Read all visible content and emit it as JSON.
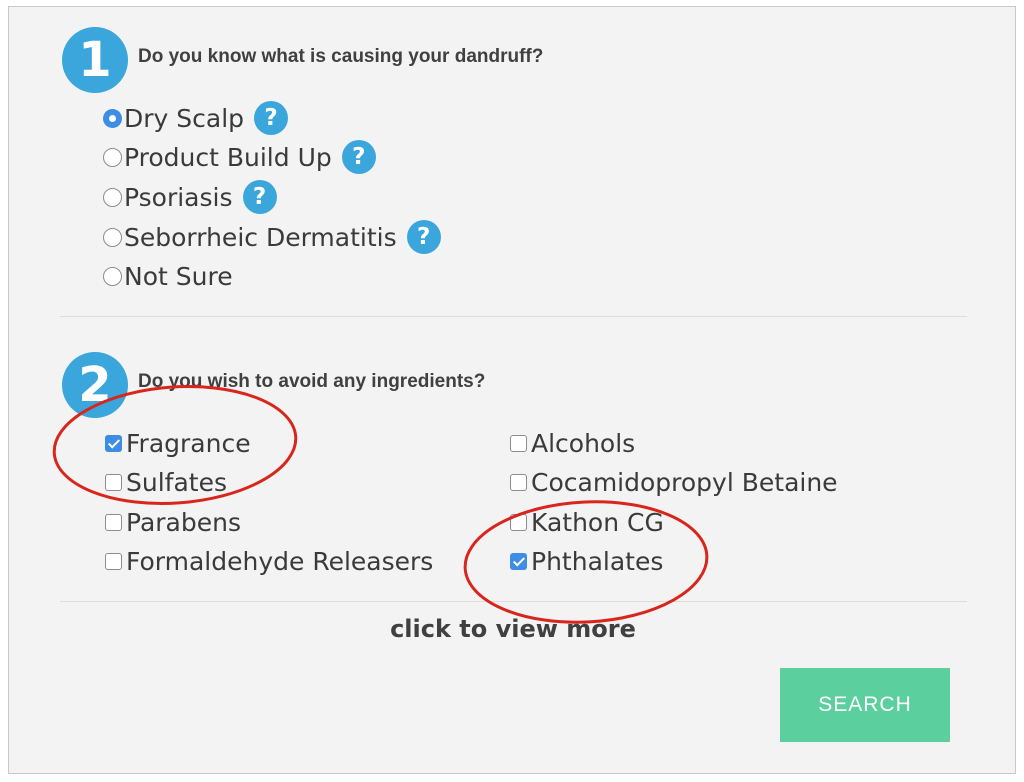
{
  "question1": {
    "number": "1",
    "text": "Do you know what is causing your dandruff?",
    "options": [
      {
        "label": "Dry Scalp",
        "selected": true,
        "help": "?"
      },
      {
        "label": "Product Build Up",
        "selected": false,
        "help": "?"
      },
      {
        "label": "Psoriasis",
        "selected": false,
        "help": "?"
      },
      {
        "label": "Seborrheic Dermatitis",
        "selected": false,
        "help": "?"
      },
      {
        "label": "Not Sure",
        "selected": false
      }
    ]
  },
  "question2": {
    "number": "2",
    "text": "Do you wish to avoid any ingredients?",
    "left_options": [
      {
        "label": "Fragrance",
        "checked": true
      },
      {
        "label": "Sulfates",
        "checked": false
      },
      {
        "label": "Parabens",
        "checked": false
      },
      {
        "label": "Formaldehyde Releasers",
        "checked": false
      }
    ],
    "right_options": [
      {
        "label": "Alcohols",
        "checked": false
      },
      {
        "label": "Cocamidopropyl Betaine",
        "checked": false
      },
      {
        "label": "Kathon CG",
        "checked": false
      },
      {
        "label": "Phthalates",
        "checked": true
      }
    ]
  },
  "view_more": "click to view more",
  "search_button": "SEARCH",
  "colors": {
    "accent_blue": "#3aa6dc",
    "checked_blue": "#3d8de6",
    "search_green": "#5ccf9e",
    "annotation_red": "#d9261c",
    "panel_bg": "#f3f3f3"
  }
}
